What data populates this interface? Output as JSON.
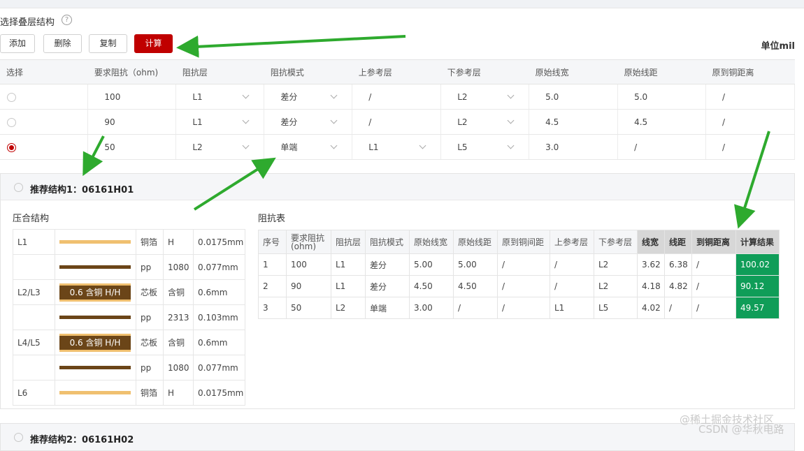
{
  "header": {
    "title": "选择叠层结构",
    "help_icon": "?"
  },
  "toolbar": {
    "add_label": "添加",
    "delete_label": "删除",
    "copy_label": "复制",
    "calc_label": "计算",
    "unit_label": "单位mil"
  },
  "main_table": {
    "headers": [
      "选择",
      "要求阻抗（ohm)",
      "阻抗层",
      "阻抗模式",
      "上参考层",
      "下参考层",
      "原始线宽",
      "原始线距",
      "原到铜距离"
    ],
    "rows": [
      {
        "selected": false,
        "impedance": "100",
        "layer": "L1",
        "mode": "差分",
        "upper_ref": "/",
        "lower_ref": "L2",
        "width": "5.0",
        "spacing": "5.0",
        "to_copper": "/"
      },
      {
        "selected": false,
        "impedance": "90",
        "layer": "L1",
        "mode": "差分",
        "upper_ref": "/",
        "lower_ref": "L2",
        "width": "4.5",
        "spacing": "4.5",
        "to_copper": "/"
      },
      {
        "selected": true,
        "impedance": "50",
        "layer": "L2",
        "mode": "单端",
        "upper_ref": "L1",
        "lower_ref": "L5",
        "width": "3.0",
        "spacing": "/",
        "to_copper": "/"
      }
    ]
  },
  "recommend1": {
    "title": "推荐结构1：06161H01"
  },
  "stack": {
    "title": "压合结构",
    "rows": [
      {
        "layer": "L1",
        "graphic": "foil",
        "material": "铜箔",
        "spec": "H",
        "thickness": "0.0175mm"
      },
      {
        "layer": "",
        "graphic": "pp",
        "material": "pp",
        "spec": "1080",
        "thickness": "0.077mm"
      },
      {
        "layer": "L2/L3",
        "graphic": "core",
        "core_label": "0.6 含铜 H/H",
        "material": "芯板",
        "spec": "含铜",
        "thickness": "0.6mm"
      },
      {
        "layer": "",
        "graphic": "pp",
        "material": "pp",
        "spec": "2313",
        "thickness": "0.103mm"
      },
      {
        "layer": "L4/L5",
        "graphic": "core",
        "core_label": "0.6 含铜 H/H",
        "material": "芯板",
        "spec": "含铜",
        "thickness": "0.6mm"
      },
      {
        "layer": "",
        "graphic": "pp",
        "material": "pp",
        "spec": "1080",
        "thickness": "0.077mm"
      },
      {
        "layer": "L6",
        "graphic": "foil",
        "material": "铜箔",
        "spec": "H",
        "thickness": "0.0175mm"
      }
    ]
  },
  "impedance_table": {
    "title": "阻抗表",
    "headers": [
      "序号",
      "要求阻抗\n(ohm)",
      "阻抗层",
      "阻抗模式",
      "原始线宽",
      "原始线距",
      "原到铜间距",
      "上参考层",
      "下参考层",
      "线宽",
      "线距",
      "到铜距离",
      "计算结果"
    ],
    "rows": [
      [
        "1",
        "100",
        "L1",
        "差分",
        "5.00",
        "5.00",
        "/",
        "/",
        "L2",
        "3.62",
        "6.38",
        "/",
        "100.02"
      ],
      [
        "2",
        "90",
        "L1",
        "差分",
        "4.50",
        "4.50",
        "/",
        "/",
        "L2",
        "4.18",
        "4.82",
        "/",
        "90.12"
      ],
      [
        "3",
        "50",
        "L2",
        "单端",
        "3.00",
        "/",
        "/",
        "L1",
        "L5",
        "4.02",
        "/",
        "/",
        "49.57"
      ]
    ]
  },
  "recommend2": {
    "title": "推荐结构2：06161H02"
  },
  "watermarks": {
    "line1": "@稀土掘金技术社区",
    "line2": "CSDN @华秋电路"
  },
  "colors": {
    "primary": "#c00000",
    "result_green": "#0f9d58",
    "arrow_green": "#2eaa2e",
    "foil": "#f0c070",
    "pp": "#6b4518"
  }
}
